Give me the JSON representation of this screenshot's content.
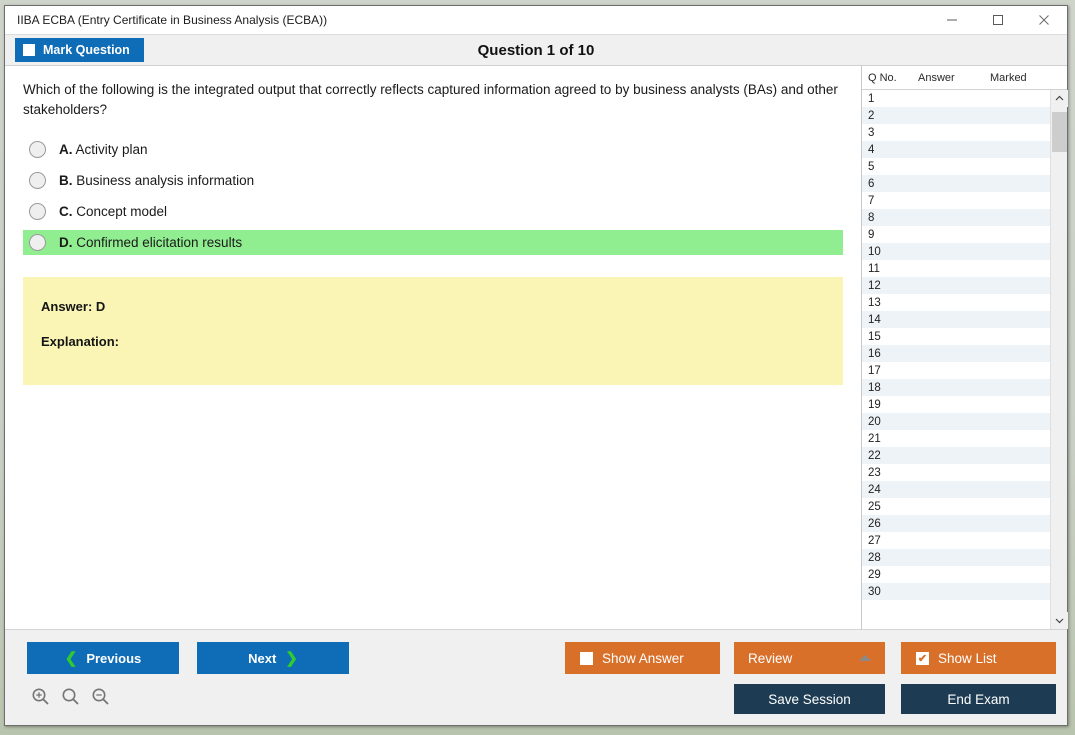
{
  "window": {
    "title": "IIBA ECBA (Entry Certificate in Business Analysis (ECBA))",
    "minimize_label": "—",
    "maximize_label": "□",
    "close_label": "✕",
    "accent_blue": "#0f6cb6",
    "accent_orange": "#d9702a",
    "accent_navy": "#1d3c53",
    "correct_green": "#90EE90",
    "answer_yellow": "#faf5b4"
  },
  "header": {
    "mark_question_label": "Mark Question",
    "question_title": "Question 1 of 10"
  },
  "question": {
    "text": "Which of the following is the integrated output that correctly reflects captured information agreed to by business analysts (BAs) and other stakeholders?",
    "options": [
      {
        "letter": "A.",
        "text": "Activity plan",
        "correct": false
      },
      {
        "letter": "B.",
        "text": "Business analysis information",
        "correct": false
      },
      {
        "letter": "C.",
        "text": "Concept model",
        "correct": false
      },
      {
        "letter": "D.",
        "text": "Confirmed elicitation results",
        "correct": true
      }
    ]
  },
  "answer_panel": {
    "answer_line": "Answer: D",
    "explanation_line": "Explanation:"
  },
  "question_list": {
    "columns": [
      "Q No.",
      "Answer",
      "Marked"
    ],
    "rows": [
      {
        "no": "1",
        "answer": "",
        "marked": ""
      },
      {
        "no": "2",
        "answer": "",
        "marked": ""
      },
      {
        "no": "3",
        "answer": "",
        "marked": ""
      },
      {
        "no": "4",
        "answer": "",
        "marked": ""
      },
      {
        "no": "5",
        "answer": "",
        "marked": ""
      },
      {
        "no": "6",
        "answer": "",
        "marked": ""
      },
      {
        "no": "7",
        "answer": "",
        "marked": ""
      },
      {
        "no": "8",
        "answer": "",
        "marked": ""
      },
      {
        "no": "9",
        "answer": "",
        "marked": ""
      },
      {
        "no": "10",
        "answer": "",
        "marked": ""
      },
      {
        "no": "11",
        "answer": "",
        "marked": ""
      },
      {
        "no": "12",
        "answer": "",
        "marked": ""
      },
      {
        "no": "13",
        "answer": "",
        "marked": ""
      },
      {
        "no": "14",
        "answer": "",
        "marked": ""
      },
      {
        "no": "15",
        "answer": "",
        "marked": ""
      },
      {
        "no": "16",
        "answer": "",
        "marked": ""
      },
      {
        "no": "17",
        "answer": "",
        "marked": ""
      },
      {
        "no": "18",
        "answer": "",
        "marked": ""
      },
      {
        "no": "19",
        "answer": "",
        "marked": ""
      },
      {
        "no": "20",
        "answer": "",
        "marked": ""
      },
      {
        "no": "21",
        "answer": "",
        "marked": ""
      },
      {
        "no": "22",
        "answer": "",
        "marked": ""
      },
      {
        "no": "23",
        "answer": "",
        "marked": ""
      },
      {
        "no": "24",
        "answer": "",
        "marked": ""
      },
      {
        "no": "25",
        "answer": "",
        "marked": ""
      },
      {
        "no": "26",
        "answer": "",
        "marked": ""
      },
      {
        "no": "27",
        "answer": "",
        "marked": ""
      },
      {
        "no": "28",
        "answer": "",
        "marked": ""
      },
      {
        "no": "29",
        "answer": "",
        "marked": ""
      },
      {
        "no": "30",
        "answer": "",
        "marked": ""
      }
    ],
    "scroll_up_label": "⌃",
    "scroll_down_label": "⌄"
  },
  "footer": {
    "previous_label": "Previous",
    "previous_chevron": "❮",
    "next_label": "Next",
    "next_chevron": "❯",
    "show_answer_label": "Show Answer",
    "show_answer_checked": false,
    "review_label": "Review",
    "show_list_label": "Show List",
    "show_list_checked": true,
    "show_list_check_glyph": "✔",
    "save_session_label": "Save Session",
    "end_exam_label": "End Exam",
    "zoom_in_label": "zoom-in",
    "zoom_reset_label": "zoom-reset",
    "zoom_out_label": "zoom-out"
  }
}
